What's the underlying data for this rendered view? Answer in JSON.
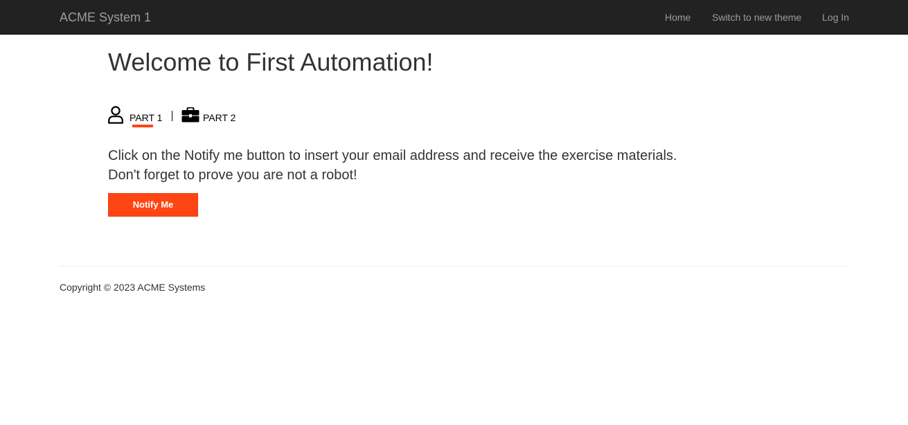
{
  "navbar": {
    "brand": "ACME System 1",
    "links": [
      {
        "label": "Home"
      },
      {
        "label": "Switch to new theme"
      },
      {
        "label": "Log In"
      }
    ]
  },
  "main": {
    "title": "Welcome to First Automation!",
    "tabs": [
      {
        "label": "PART 1",
        "icon": "user-icon",
        "active": true
      },
      {
        "label": "PART 2",
        "icon": "briefcase-icon",
        "active": false
      }
    ],
    "instructions": [
      "Click on the Notify me button to insert your email address and receive the exercise materials.",
      "Don't forget to prove you are not a robot!"
    ],
    "notify_button": "Notify Me"
  },
  "footer": {
    "copyright": "Copyright © 2023 ACME Systems"
  },
  "colors": {
    "navbar_bg": "#222222",
    "nav_text": "#9d9d9d",
    "accent": "#ff4514",
    "body_text": "#333333"
  }
}
